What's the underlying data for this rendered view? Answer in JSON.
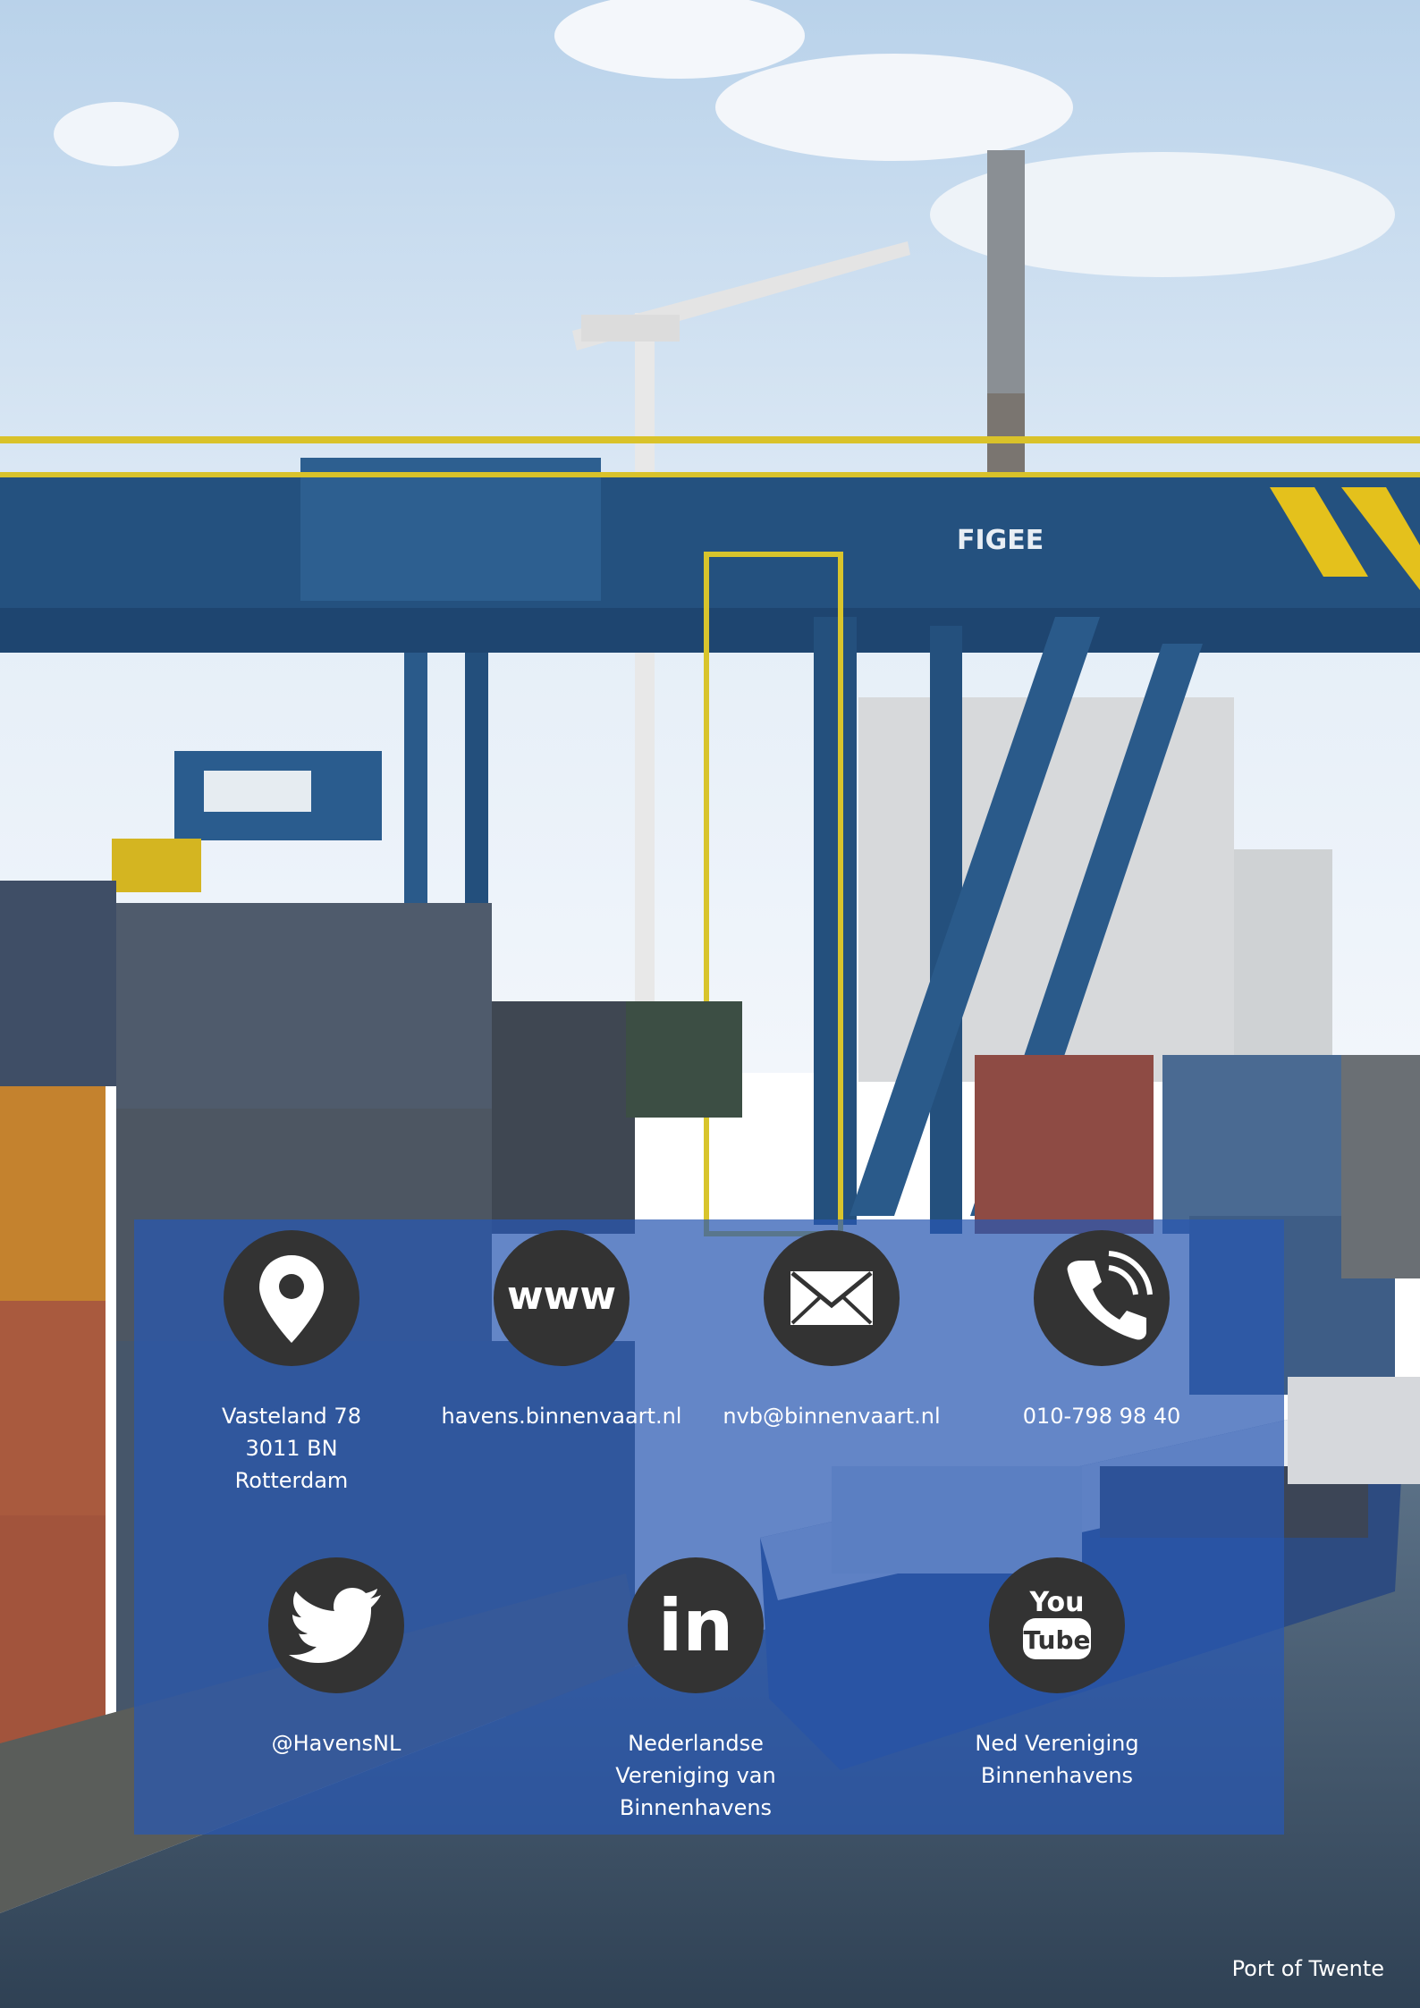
{
  "contacts": {
    "address": {
      "icon": "map-pin-icon",
      "lines": [
        "Vasteland 78",
        "3011 BN",
        "Rotterdam"
      ]
    },
    "website": {
      "icon": "www-icon",
      "icon_text": "www",
      "lines": [
        "havens.binnenvaart.nl"
      ]
    },
    "email": {
      "icon": "envelope-icon",
      "lines": [
        "nvb@binnenvaart.nl"
      ]
    },
    "phone": {
      "icon": "phone-icon",
      "lines": [
        "010-798 98 40"
      ]
    }
  },
  "social": {
    "twitter": {
      "icon": "twitter-icon",
      "lines": [
        "@HavensNL"
      ]
    },
    "linkedin": {
      "icon": "linkedin-icon",
      "icon_text": "in",
      "lines": [
        "Nederlandse",
        "Vereniging van",
        "Binnenhavens"
      ]
    },
    "youtube": {
      "icon": "youtube-icon",
      "icon_text_top": "You",
      "icon_text_bottom": "Tube",
      "lines": [
        "Ned Vereniging",
        "Binnenhavens"
      ]
    }
  },
  "footer": {
    "text": "Port of Twente"
  },
  "colors": {
    "panel": "#2858b2",
    "icon_circle": "#333333",
    "text": "#ffffff"
  }
}
